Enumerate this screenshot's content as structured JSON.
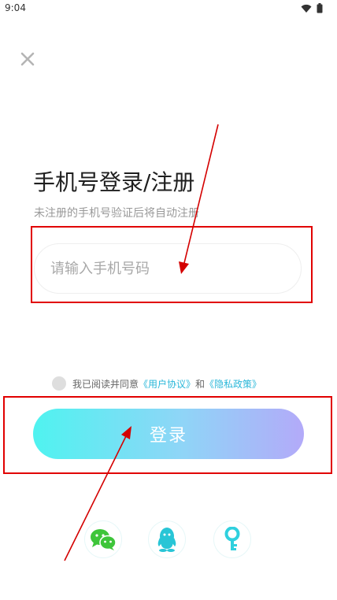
{
  "status_bar": {
    "time": "9:04"
  },
  "header": {
    "close_icon": "close-icon"
  },
  "login": {
    "title": "手机号登录/注册",
    "subtitle": "未注册的手机号验证后将自动注册",
    "phone_placeholder": "请输入手机号码",
    "phone_value": ""
  },
  "agreement": {
    "prefix": "我已阅读并同意",
    "user_agreement": "《用户协议》",
    "conjunction": "和",
    "privacy_policy": "《隐私政策》"
  },
  "actions": {
    "login_label": "登录"
  },
  "social_login": [
    {
      "icon": "wechat-icon",
      "color": "#3ec53a"
    },
    {
      "icon": "qq-icon",
      "color": "#28c5d6"
    },
    {
      "icon": "key-icon",
      "color": "#2fd0de"
    }
  ],
  "colors": {
    "accent": "#2ab7d9",
    "annotation": "#e10000",
    "login_gradient_start": "#4ff3f0",
    "login_gradient_end": "#b3aaf9"
  }
}
